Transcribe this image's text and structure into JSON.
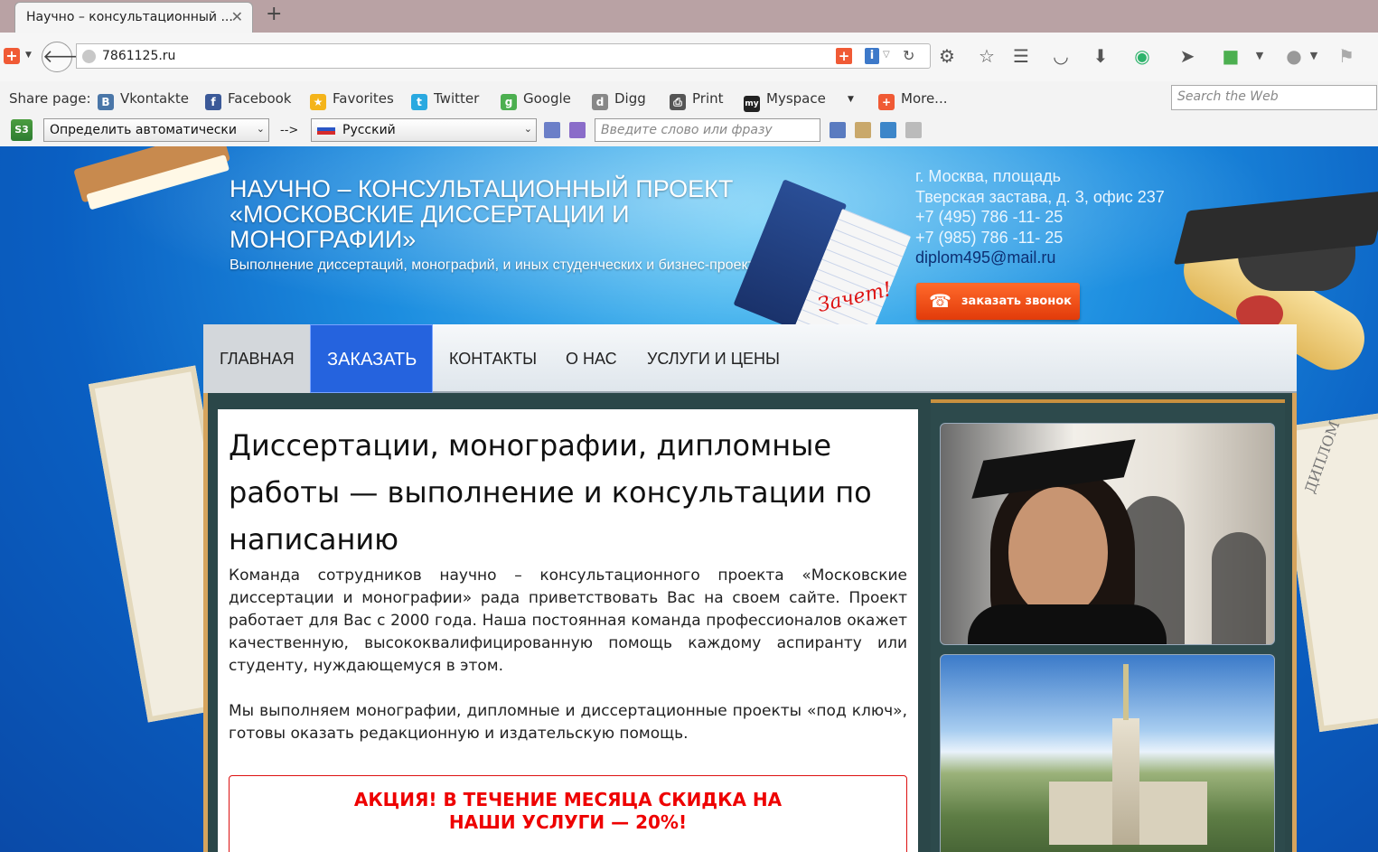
{
  "browser": {
    "tab_title": "Научно – консультационный ...",
    "tab_close": "✕",
    "new_tab": "+",
    "url": "7861125.ru",
    "share": {
      "label": "Share page:",
      "items": [
        {
          "label": "Vkontakte",
          "icon": "vkontakte-icon",
          "color": "#4a76a8",
          "glyph": "B"
        },
        {
          "label": "Facebook",
          "icon": "facebook-icon",
          "color": "#3b5998",
          "glyph": "f"
        },
        {
          "label": "Favorites",
          "icon": "star-icon",
          "color": "#f4b41a",
          "glyph": "★"
        },
        {
          "label": "Twitter",
          "icon": "twitter-icon",
          "color": "#2aa9e0",
          "glyph": "t"
        },
        {
          "label": "Google",
          "icon": "google-icon",
          "color": "#4caf50",
          "glyph": "g"
        },
        {
          "label": "Digg",
          "icon": "digg-icon",
          "color": "#888888",
          "glyph": "d"
        },
        {
          "label": "Print",
          "icon": "printer-icon",
          "color": "#555555",
          "glyph": "⎙"
        },
        {
          "label": "Myspace",
          "icon": "myspace-icon",
          "color": "#222222",
          "glyph": "my"
        },
        {
          "label": "More...",
          "icon": "plus-icon",
          "color": "#f05a35",
          "glyph": "+"
        }
      ],
      "search_placeholder": "Search the Web"
    },
    "translate": {
      "source_language": "Определить автоматически",
      "arrow": "-->",
      "target_language": "Русский",
      "input_placeholder": "Введите слово или фразу"
    }
  },
  "site": {
    "title": "НАУЧНО – КОНСУЛЬТАЦИОННЫЙ ПРОЕКТ «МОСКОВСКИЕ ДИССЕРТАЦИИ И МОНОГРАФИИ»",
    "slogan": "Выполнение диссертаций, монографий, и иных студенческих и бизнес-проектов.",
    "contact": {
      "address_line1": "г. Москва, площадь",
      "address_line2": "Тверская застава, д. 3, офис 237",
      "phone1": "+7 (495) 786 -11- 25",
      "phone2": "+7 (985) 786 -11- 25",
      "email": "diplom495@mail.ru"
    },
    "callback_button": "заказать звонок",
    "nav": [
      "ГЛАВНАЯ",
      "ЗАКАЗАТЬ",
      "КОНТАКТЫ",
      "О НАС",
      "УСЛУГИ И ЦЕНЫ"
    ],
    "decor": {
      "recordbook_stamp": "Зачет!",
      "diploma_word": "ДИПЛОМ"
    },
    "article": {
      "title": "Диссертации, монографии, дипломные работы — выполнение и консультации по написанию",
      "paragraph1": "Команда сотрудников научно – консультационного проекта «Московские диссертации и монографии» рада приветствовать Вас на своем сайте. Проект работает для Вас с 2000 года. Наша постоянная команда профессионалов окажет качественную, высококвалифицированную помощь каждому аспиранту или студенту, нуждающемуся в этом.",
      "paragraph2": "Мы выполняем монографии, дипломные и диссертационные проекты «под ключ», готовы оказать редакционную и издательскую помощь.",
      "promo": "АКЦИЯ! В ТЕЧЕНИЕ МЕСЯЦА СКИДКА НА НАШИ УСЛУГИ — 20%!"
    }
  }
}
